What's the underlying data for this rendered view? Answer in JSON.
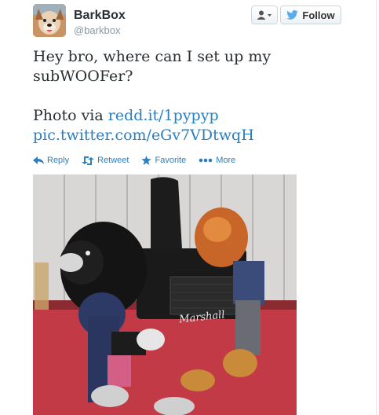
{
  "account": {
    "name": "BarkBox",
    "handle": "@barkbox"
  },
  "buttons": {
    "follow_label": "Follow"
  },
  "tweet": {
    "line1": "Hey bro, where can I set up my",
    "line2": "subWOOFer?",
    "photo_prefix": "Photo via",
    "link1": "redd.it/1pypyp",
    "link2": "pic.twitter.com/eGv7VDtwqH"
  },
  "actions": {
    "reply": "Reply",
    "retweet": "Retweet",
    "favorite": "Favorite",
    "more": "More"
  },
  "photo": {
    "amp_logo_text": "Marshall"
  },
  "icons": [
    "user-dropdown-icon",
    "twitter-bird-icon",
    "reply-icon",
    "retweet-icon",
    "star-icon",
    "more-dots-icon"
  ],
  "colors": {
    "link": "#2a7fc1",
    "twitter_blue": "#55acee",
    "secondary_text": "#8899a6"
  }
}
